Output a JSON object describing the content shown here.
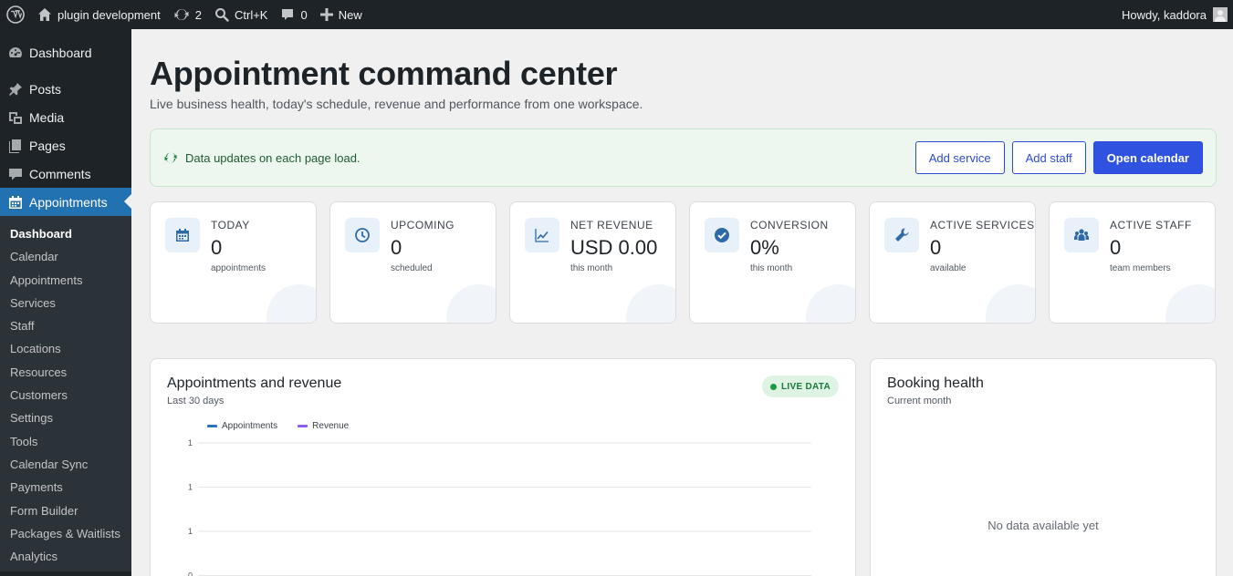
{
  "adminbar": {
    "site_name": "plugin development",
    "updates_count": "2",
    "search_shortcut": "Ctrl+K",
    "comments_count": "0",
    "new_label": "New",
    "greeting": "Howdy, kaddora"
  },
  "menu": {
    "dashboard": "Dashboard",
    "posts": "Posts",
    "media": "Media",
    "pages": "Pages",
    "comments": "Comments",
    "appointments": "Appointments",
    "submenu": [
      "Dashboard",
      "Calendar",
      "Appointments",
      "Services",
      "Staff",
      "Locations",
      "Resources",
      "Customers",
      "Settings",
      "Tools",
      "Calendar Sync",
      "Payments",
      "Form Builder",
      "Packages & Waitlists",
      "Analytics"
    ]
  },
  "page": {
    "title": "Appointment command center",
    "subtitle": "Live business health, today's schedule, revenue and performance from one workspace."
  },
  "notice": {
    "text": "Data updates on each page load.",
    "add_service": "Add service",
    "add_staff": "Add staff",
    "open_calendar": "Open calendar"
  },
  "stats": [
    {
      "icon": "calendar-icon",
      "label": "TODAY",
      "value": "0",
      "note": "appointments"
    },
    {
      "icon": "clock-icon",
      "label": "UPCOMING",
      "value": "0",
      "note": "scheduled"
    },
    {
      "icon": "chart-line-icon",
      "label": "NET REVENUE",
      "value": "USD 0.00",
      "note": "this month"
    },
    {
      "icon": "check-circle-icon",
      "label": "CONVERSION",
      "value": "0%",
      "note": "this month"
    },
    {
      "icon": "wrench-icon",
      "label": "ACTIVE SERVICES",
      "value": "0",
      "note": "available"
    },
    {
      "icon": "users-icon",
      "label": "ACTIVE STAFF",
      "value": "0",
      "note": "team members"
    }
  ],
  "appointments_panel": {
    "title": "Appointments and revenue",
    "subtitle": "Last 30 days",
    "badge": "LIVE DATA"
  },
  "booking_panel": {
    "title": "Booking health",
    "subtitle": "Current month",
    "empty_text": "No data available yet"
  },
  "colors": {
    "accent": "#2f52e0",
    "menu_current": "#2271b1",
    "appointments_series": "#2e6fbf",
    "revenue_series": "#8b5cf6"
  },
  "chart_data": {
    "type": "line",
    "x": [],
    "series": [
      {
        "name": "Appointments",
        "values": []
      },
      {
        "name": "Revenue",
        "values": []
      }
    ],
    "yticks": [
      "1",
      "1",
      "1",
      "0"
    ],
    "legend": "top-left",
    "grid": true
  }
}
